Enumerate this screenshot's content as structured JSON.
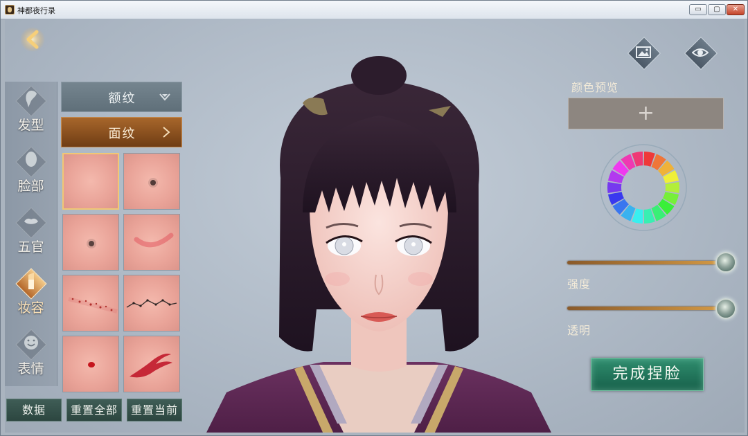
{
  "window": {
    "title": "神都夜行录",
    "minimize_label": "▭",
    "maximize_label": "▢",
    "close_label": "✕"
  },
  "sidebar": {
    "items": [
      {
        "label": "发型",
        "icon": "hair-icon",
        "active": false
      },
      {
        "label": "脸部",
        "icon": "face-icon",
        "active": false
      },
      {
        "label": "五官",
        "icon": "lips-icon",
        "active": false
      },
      {
        "label": "妆容",
        "icon": "lipstick-icon",
        "active": true
      },
      {
        "label": "表情",
        "icon": "smile-icon",
        "active": false
      }
    ]
  },
  "panel": {
    "category_header": "额纹",
    "category_sub": "面纹",
    "swatches": [
      {
        "pattern": "blank",
        "selected": true
      },
      {
        "pattern": "mole"
      },
      {
        "pattern": "mole-lower"
      },
      {
        "pattern": "blush-crescent"
      },
      {
        "pattern": "freckles"
      },
      {
        "pattern": "dotted-brow"
      },
      {
        "pattern": "red-dot"
      },
      {
        "pattern": "swirl"
      }
    ]
  },
  "footer": {
    "data_label": "数据",
    "reset_all_label": "重置全部",
    "reset_current_label": "重置当前"
  },
  "right_panel": {
    "preview_label": "颜色预览",
    "preview_plus": "+",
    "strength_label": "强度",
    "strength_value": 1.0,
    "opacity_label": "透明",
    "opacity_value": 1.0,
    "finish_label": "完成捏脸"
  },
  "colors": {
    "accent_gold": "#f1c774",
    "finish_green": "#1f7a5c",
    "selected_tab": "#a8672b"
  }
}
